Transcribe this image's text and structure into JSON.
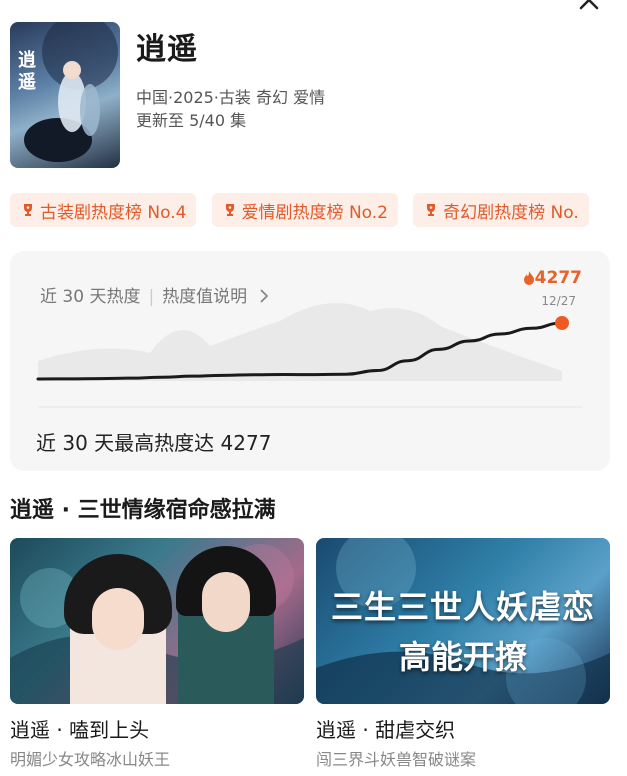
{
  "show": {
    "title": "逍遥",
    "meta": "中国·2025·古装 奇幻 爱情",
    "update": "更新至 5/40 集",
    "poster_text": "逍遥"
  },
  "badges": [
    {
      "label": "古装剧热度榜 No.4"
    },
    {
      "label": "爱情剧热度榜 No.2"
    },
    {
      "label": "奇幻剧热度榜 No."
    }
  ],
  "heat_card": {
    "label": "近 30 天热度",
    "help": "热度值说明",
    "current_value": "4277",
    "current_date": "12/27",
    "footer": "近 30 天最高热度达 4277"
  },
  "chart_data": {
    "type": "line",
    "title": "",
    "xlabel": "",
    "ylabel": "",
    "series": [
      {
        "values": [
          300,
          310,
          330,
          360,
          420,
          500,
          560,
          600,
          620,
          610,
          640,
          900,
          1600,
          2400,
          3000,
          3500,
          3900,
          4277
        ]
      }
    ],
    "annotations": [
      {
        "label": "4277",
        "date": "12/27"
      }
    ],
    "grid": false,
    "colors": {
      "line": "#1a1a1a",
      "endpoint": "#f05a22",
      "area": "#e9e9e9"
    }
  },
  "section": {
    "title": "逍遥 · 三世情缘宿命感拉满"
  },
  "videos": [
    {
      "title": "逍遥 · 嗑到上头",
      "subtitle": "明媚少女攻略冰山妖王",
      "overlay1": "",
      "overlay2": ""
    },
    {
      "title": "逍遥 · 甜虐交织",
      "subtitle": "闯三界斗妖兽智破谜案",
      "overlay1": "三生三世人妖虐恋",
      "overlay2": "高能开撩"
    }
  ],
  "icons": [
    "close-icon",
    "trophy-icon",
    "flame-icon",
    "chevron-right-icon"
  ]
}
